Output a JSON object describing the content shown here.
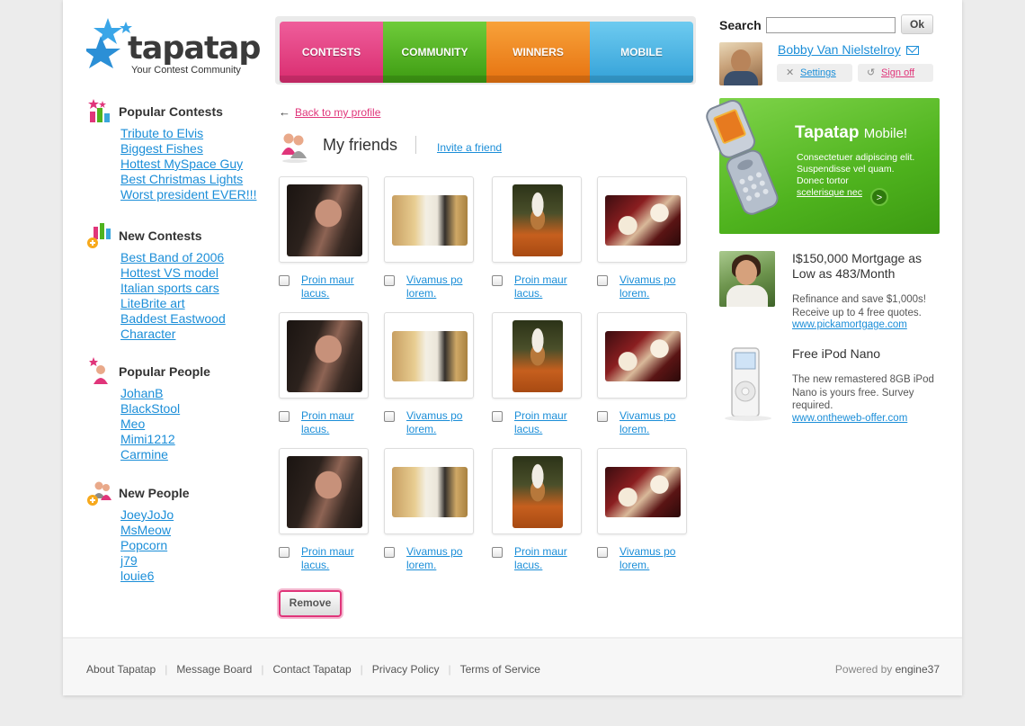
{
  "brand": {
    "name": "tapatap",
    "tagline": "Your Contest Community"
  },
  "nav": {
    "tabs": [
      "CONTESTS",
      "COMMUNITY",
      "WINNERS",
      "MOBILE"
    ]
  },
  "search": {
    "label": "Search",
    "value": "",
    "button": "Ok"
  },
  "user": {
    "name": "Bobby Van Nielstelroy",
    "settings": "Settings",
    "signoff": "Sign off"
  },
  "sidebar": {
    "popular_contests": {
      "title": "Popular Contests",
      "items": [
        "Tribute to Elvis",
        "Biggest Fishes",
        "Hottest MySpace Guy",
        "Best Christmas Lights",
        "Worst president EVER!!!"
      ]
    },
    "new_contests": {
      "title": "New Contests",
      "items": [
        "Best Band of 2006",
        "Hottest VS model",
        "Italian sports cars",
        "LiteBrite art",
        "Baddest Eastwood",
        "Character"
      ]
    },
    "popular_people": {
      "title": "Popular People",
      "items": [
        "JohanB",
        "BlackStool",
        "Meo",
        "Mimi1212",
        "Carmine"
      ]
    },
    "new_people": {
      "title": "New People",
      "items": [
        "JoeyJoJo",
        "MsMeow",
        "Popcorn",
        "j79",
        "louie6"
      ]
    }
  },
  "main": {
    "back_link": "Back to my profile",
    "back_arrow": "←",
    "title": "My friends",
    "invite": "Invite a friend",
    "friends": [
      {
        "name": "Proin maur lacus."
      },
      {
        "name": "Vivamus po lorem."
      },
      {
        "name": "Proin maur lacus."
      },
      {
        "name": "Vivamus po lorem."
      },
      {
        "name": "Proin maur lacus."
      },
      {
        "name": "Vivamus po lorem."
      },
      {
        "name": "Proin maur lacus."
      },
      {
        "name": "Vivamus po lorem."
      },
      {
        "name": "Proin maur lacus."
      },
      {
        "name": "Vivamus po lorem."
      },
      {
        "name": "Proin maur lacus."
      },
      {
        "name": "Vivamus po lorem."
      }
    ],
    "remove_button": "Remove"
  },
  "mobile_promo": {
    "title": "Tapatap",
    "title_suffix": "Mobile!",
    "line1": "Consectetuer adipiscing elit.",
    "line2": "Suspendisse vel quam.",
    "line3": "Donec tortor",
    "link": "scelerisque nec",
    "arrow": ">"
  },
  "ads": [
    {
      "title": "I$150,000 Mortgage as Low as 483/Month",
      "body": "Refinance and save $1,000s! Receive up to 4 free quotes.",
      "link": "www.pickamortgage.com"
    },
    {
      "title": "Free iPod Nano",
      "body": "The new remastered 8GB iPod Nano is yours free. Survey required.",
      "link": "www.ontheweb-offer.com"
    }
  ],
  "footer": {
    "links": [
      "About Tapatap",
      "Message Board",
      "Contact Tapatap",
      "Privacy Policy",
      "Terms of Service"
    ],
    "powered_prefix": "Powered by",
    "powered_brand": "engine37"
  },
  "colors": {
    "pink": "#e0357a",
    "link": "#1b8ed8",
    "green": "#4fb31e",
    "orange": "#f28a22",
    "blue": "#3aa6dc"
  }
}
